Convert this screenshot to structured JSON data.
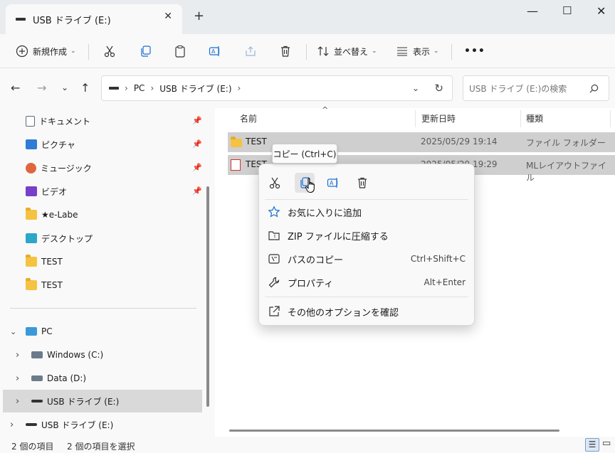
{
  "window": {
    "tab_title": "USB ドライブ (E:)",
    "new_tab": "+",
    "minimize": "—",
    "maximize": "☐",
    "close": "✕"
  },
  "toolbar": {
    "new_label": "新規作成",
    "sort_label": "並べ替え",
    "view_label": "表示",
    "more": "•••"
  },
  "address": {
    "path": [
      "PC",
      "USB ドライブ (E:)"
    ],
    "search_placeholder": "USB ドライブ (E:)の検索"
  },
  "sidebar": {
    "quick": [
      {
        "label": "ドキュメント",
        "icon": "document-icon",
        "color": "#5b6b7c",
        "pinned": true
      },
      {
        "label": "ピクチャ",
        "icon": "pictures-icon",
        "color": "#2f7bd6",
        "pinned": true
      },
      {
        "label": "ミュージック",
        "icon": "music-icon",
        "color": "#e0663d",
        "pinned": true
      },
      {
        "label": "ビデオ",
        "icon": "video-icon",
        "color": "#7a3fc9",
        "pinned": true
      },
      {
        "label": "★e-Labe",
        "icon": "folder-icon",
        "color": "#f5c242",
        "pinned": false
      },
      {
        "label": "デスクトップ",
        "icon": "desktop-icon",
        "color": "#2aa7c9",
        "pinned": false
      },
      {
        "label": "TEST",
        "icon": "folder-icon",
        "color": "#f5c242",
        "pinned": false
      },
      {
        "label": "TEST",
        "icon": "folder-icon",
        "color": "#f5c242",
        "pinned": false
      }
    ],
    "tree": [
      {
        "label": "PC",
        "icon": "pc-icon",
        "expander": "⌄"
      },
      {
        "label": "Windows (C:)",
        "icon": "drive-icon",
        "expander": "›"
      },
      {
        "label": "Data (D:)",
        "icon": "drive-icon",
        "expander": "›"
      },
      {
        "label": "USB ドライブ (E:)",
        "icon": "usb-drive-icon",
        "expander": "›"
      },
      {
        "label": "USB ドライブ (E:)",
        "icon": "usb-drive-icon",
        "expander": "›"
      }
    ]
  },
  "columns": {
    "name": "名前",
    "date": "更新日時",
    "type": "種類"
  },
  "files": [
    {
      "name": "TEST",
      "date": "2025/05/29 19:14",
      "type": "ファイル フォルダー"
    },
    {
      "name": "TEST",
      "date": "2025/05/29 19:29",
      "type": "MLレイアウトファイル"
    }
  ],
  "context_menu": {
    "tooltip": "コピー (Ctrl+C)",
    "items": [
      {
        "label": "お気に入りに追加",
        "shortcut": ""
      },
      {
        "label": "ZIP ファイルに圧縮する",
        "shortcut": ""
      },
      {
        "label": "パスのコピー",
        "shortcut": "Ctrl+Shift+C"
      },
      {
        "label": "プロパティ",
        "shortcut": "Alt+Enter"
      },
      {
        "label": "その他のオプションを確認",
        "shortcut": ""
      }
    ]
  },
  "status": {
    "count": "2 個の項目",
    "selected": "2 個の項目を選択"
  }
}
